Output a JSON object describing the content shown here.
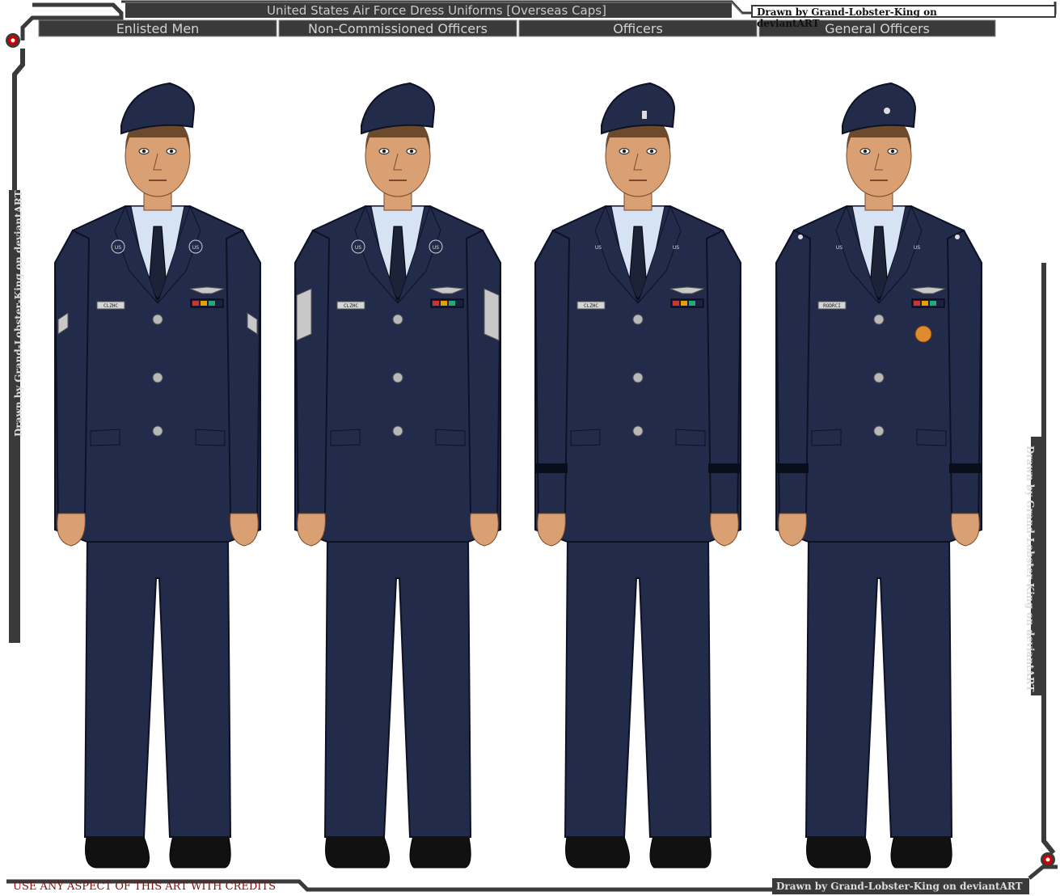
{
  "header": {
    "title": "United States Air Force Dress Uniforms [Overseas Caps]",
    "credit_top": "Drawn by Grand-Lobster-King on deviantART"
  },
  "tabs": [
    {
      "label": "Enlisted Men"
    },
    {
      "label": "Non-Commissioned Officers"
    },
    {
      "label": "Officers"
    },
    {
      "label": "General Officers"
    }
  ],
  "side": {
    "left_credit": "Drawn by Grand-Lobster-King on deviantART",
    "right_credit": "Drawn by Grand-Lobster-King on deviantART"
  },
  "footer": {
    "usage_note": "USE ANY ASPECT OF THIS ART WITH CREDITS",
    "credit_bottom": "Drawn by Grand-Lobster-King on deviantART"
  },
  "figures": [
    {
      "collar_text": "US",
      "nametag": "CLZHC"
    },
    {
      "collar_text": "US",
      "nametag": "CLZHC"
    },
    {
      "collar_text": "US",
      "nametag": "CLZHC"
    },
    {
      "collar_text": "US",
      "nametag": "RODRCI"
    }
  ],
  "colors": {
    "uniform": "#232b4b",
    "uniform_outline": "#0d1124",
    "shirt": "#d5e3f5",
    "skin": "#d9a073",
    "hair": "#6b4a2e",
    "frame_dark": "#3a3a3a",
    "frame_light": "#9a9a9a",
    "accent_red": "#cc0000"
  }
}
